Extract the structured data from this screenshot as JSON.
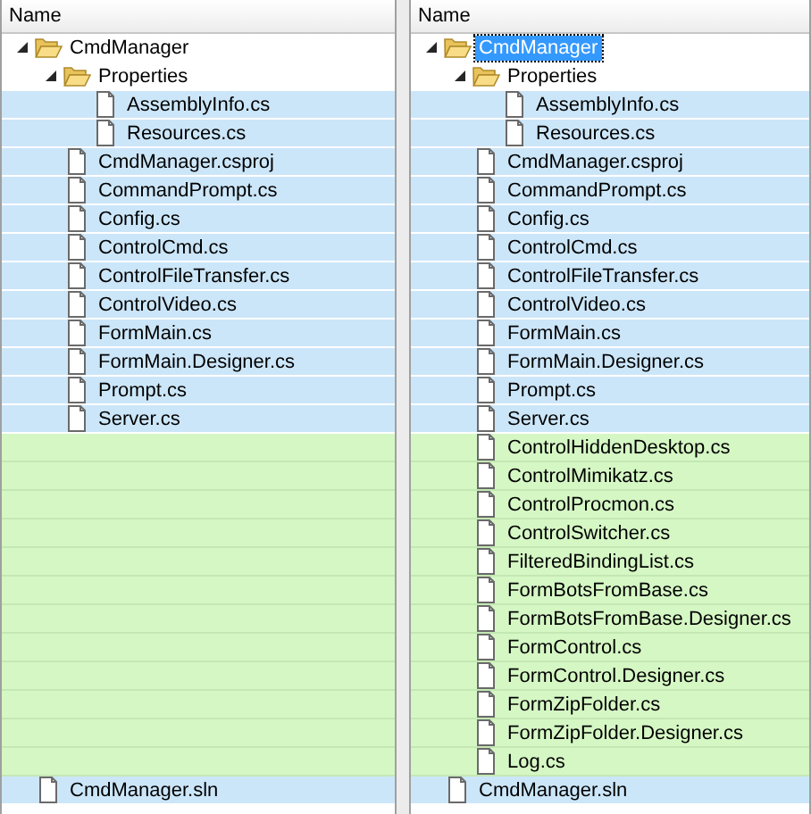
{
  "panels": [
    {
      "header": "Name",
      "items": [
        {
          "kind": "folder",
          "label": "CmdManager",
          "color": "#ffffff",
          "expanded": true,
          "selected": false,
          "children": [
            {
              "kind": "folder",
              "label": "Properties",
              "color": "#ffffff",
              "expanded": true,
              "selected": false,
              "children": [
                {
                  "kind": "file",
                  "label": "AssemblyInfo.cs",
                  "color": "#cce6f9",
                  "selected": false
                },
                {
                  "kind": "file",
                  "label": "Resources.cs",
                  "color": "#cce6f9",
                  "selected": false
                }
              ]
            },
            {
              "kind": "file",
              "label": "CmdManager.csproj",
              "color": "#cce6f9",
              "selected": false
            },
            {
              "kind": "file",
              "label": "CommandPrompt.cs",
              "color": "#cce6f9",
              "selected": false
            },
            {
              "kind": "file",
              "label": "Config.cs",
              "color": "#cce6f9",
              "selected": false
            },
            {
              "kind": "file",
              "label": "ControlCmd.cs",
              "color": "#cce6f9",
              "selected": false
            },
            {
              "kind": "file",
              "label": "ControlFileTransfer.cs",
              "color": "#cce6f9",
              "selected": false
            },
            {
              "kind": "file",
              "label": "ControlVideo.cs",
              "color": "#cce6f9",
              "selected": false
            },
            {
              "kind": "file",
              "label": "FormMain.cs",
              "color": "#cce6f9",
              "selected": false
            },
            {
              "kind": "file",
              "label": "FormMain.Designer.cs",
              "color": "#cce6f9",
              "selected": false
            },
            {
              "kind": "file",
              "label": "Prompt.cs",
              "color": "#cce6f9",
              "selected": false
            },
            {
              "kind": "file",
              "label": "Server.cs",
              "color": "#cce6f9",
              "selected": false
            },
            {
              "kind": "gap",
              "color": "#d5f7c4"
            },
            {
              "kind": "gap",
              "color": "#d5f7c4"
            },
            {
              "kind": "gap",
              "color": "#d5f7c4"
            },
            {
              "kind": "gap",
              "color": "#d5f7c4"
            },
            {
              "kind": "gap",
              "color": "#d5f7c4"
            },
            {
              "kind": "gap",
              "color": "#d5f7c4"
            },
            {
              "kind": "gap",
              "color": "#d5f7c4"
            },
            {
              "kind": "gap",
              "color": "#d5f7c4"
            },
            {
              "kind": "gap",
              "color": "#d5f7c4"
            },
            {
              "kind": "gap",
              "color": "#d5f7c4"
            },
            {
              "kind": "gap",
              "color": "#d5f7c4"
            },
            {
              "kind": "gap",
              "color": "#d5f7c4"
            }
          ]
        },
        {
          "kind": "file",
          "label": "CmdManager.sln",
          "color": "#cce6f9",
          "selected": false
        }
      ]
    },
    {
      "header": "Name",
      "items": [
        {
          "kind": "folder",
          "label": "CmdManager",
          "color": "#ffffff",
          "expanded": true,
          "selected": true,
          "children": [
            {
              "kind": "folder",
              "label": "Properties",
              "color": "#ffffff",
              "expanded": true,
              "selected": false,
              "children": [
                {
                  "kind": "file",
                  "label": "AssemblyInfo.cs",
                  "color": "#cce6f9",
                  "selected": false
                },
                {
                  "kind": "file",
                  "label": "Resources.cs",
                  "color": "#cce6f9",
                  "selected": false
                }
              ]
            },
            {
              "kind": "file",
              "label": "CmdManager.csproj",
              "color": "#cce6f9",
              "selected": false
            },
            {
              "kind": "file",
              "label": "CommandPrompt.cs",
              "color": "#cce6f9",
              "selected": false
            },
            {
              "kind": "file",
              "label": "Config.cs",
              "color": "#cce6f9",
              "selected": false
            },
            {
              "kind": "file",
              "label": "ControlCmd.cs",
              "color": "#cce6f9",
              "selected": false
            },
            {
              "kind": "file",
              "label": "ControlFileTransfer.cs",
              "color": "#cce6f9",
              "selected": false
            },
            {
              "kind": "file",
              "label": "ControlVideo.cs",
              "color": "#cce6f9",
              "selected": false
            },
            {
              "kind": "file",
              "label": "FormMain.cs",
              "color": "#cce6f9",
              "selected": false
            },
            {
              "kind": "file",
              "label": "FormMain.Designer.cs",
              "color": "#cce6f9",
              "selected": false
            },
            {
              "kind": "file",
              "label": "Prompt.cs",
              "color": "#cce6f9",
              "selected": false
            },
            {
              "kind": "file",
              "label": "Server.cs",
              "color": "#cce6f9",
              "selected": false
            },
            {
              "kind": "file",
              "label": "ControlHiddenDesktop.cs",
              "color": "#d5f7c4",
              "selected": false
            },
            {
              "kind": "file",
              "label": "ControlMimikatz.cs",
              "color": "#d5f7c4",
              "selected": false
            },
            {
              "kind": "file",
              "label": "ControlProcmon.cs",
              "color": "#d5f7c4",
              "selected": false
            },
            {
              "kind": "file",
              "label": "ControlSwitcher.cs",
              "color": "#d5f7c4",
              "selected": false
            },
            {
              "kind": "file",
              "label": "FilteredBindingList.cs",
              "color": "#d5f7c4",
              "selected": false
            },
            {
              "kind": "file",
              "label": "FormBotsFromBase.cs",
              "color": "#d5f7c4",
              "selected": false
            },
            {
              "kind": "file",
              "label": "FormBotsFromBase.Designer.cs",
              "color": "#d5f7c4",
              "selected": false
            },
            {
              "kind": "file",
              "label": "FormControl.cs",
              "color": "#d5f7c4",
              "selected": false
            },
            {
              "kind": "file",
              "label": "FormControl.Designer.cs",
              "color": "#d5f7c4",
              "selected": false
            },
            {
              "kind": "file",
              "label": "FormZipFolder.cs",
              "color": "#d5f7c4",
              "selected": false
            },
            {
              "kind": "file",
              "label": "FormZipFolder.Designer.cs",
              "color": "#d5f7c4",
              "selected": false
            },
            {
              "kind": "file",
              "label": "Log.cs",
              "color": "#d5f7c4",
              "selected": false
            }
          ]
        },
        {
          "kind": "file",
          "label": "CmdManager.sln",
          "color": "#cce6f9",
          "selected": false
        }
      ]
    }
  ]
}
